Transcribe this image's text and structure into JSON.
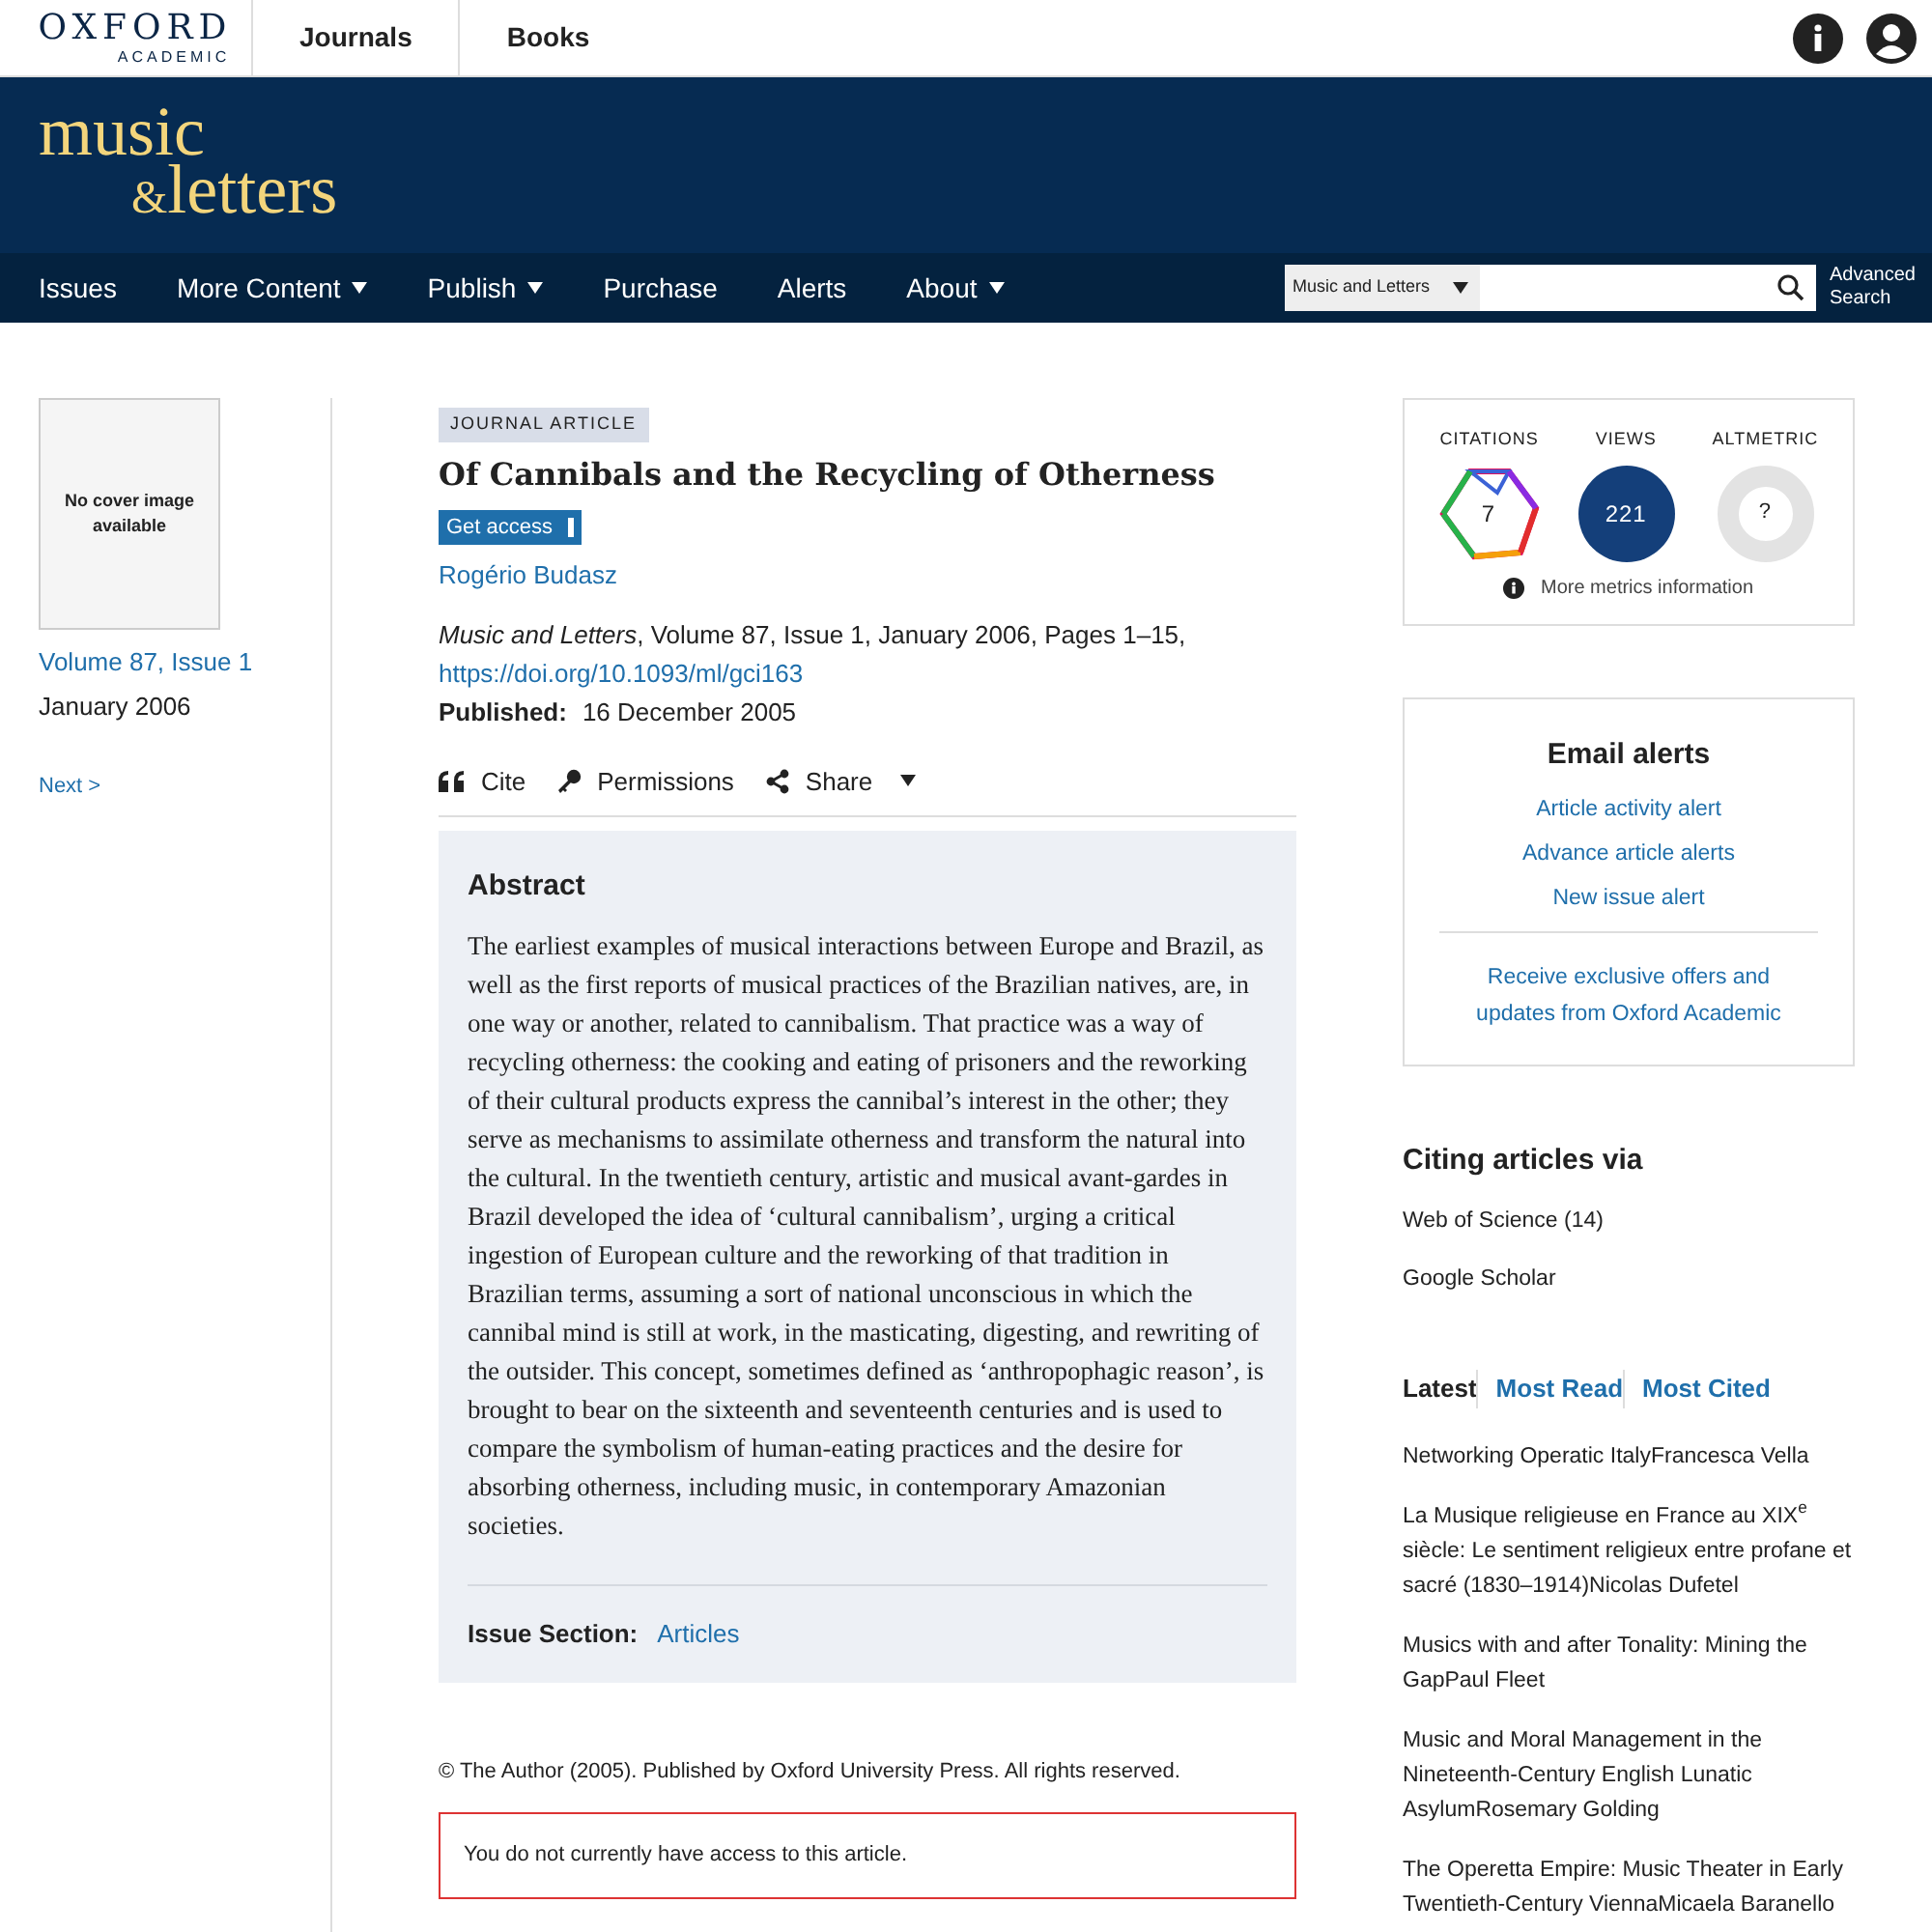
{
  "header": {
    "logo_name": "OXFORD",
    "logo_sub": "ACADEMIC",
    "links": [
      {
        "label": "Journals"
      },
      {
        "label": "Books"
      }
    ]
  },
  "journal_logo": {
    "line_1": "music",
    "ampersand": "&",
    "line_2": "letters"
  },
  "nav": {
    "items": [
      {
        "label": "Issues",
        "has_menu": false
      },
      {
        "label": "More Content",
        "has_menu": true
      },
      {
        "label": "Publish",
        "has_menu": true
      },
      {
        "label": "Purchase",
        "has_menu": false
      },
      {
        "label": "Alerts",
        "has_menu": false
      },
      {
        "label": "About",
        "has_menu": true
      }
    ],
    "search": {
      "scope": "Music and Letters",
      "advanced": "Advanced Search"
    }
  },
  "issue_sidebar": {
    "cover_text": "No cover image available",
    "issue": "Volume 87, Issue 1",
    "date": "January 2006",
    "next": "Next >"
  },
  "article": {
    "type": "JOURNAL ARTICLE",
    "title": "Of Cannibals and the Recycling of Otherness",
    "get_access": "Get access",
    "author": "Rogério Budasz",
    "citation": "*Music and Letters*, Volume 87, Issue 1, January 2006, Pages 1–15,",
    "doi": "https://doi.org/10.1093/ml/gci163",
    "published_label": "Published:",
    "published_date": "16 December 2005",
    "tools": [
      {
        "kind": "cite",
        "label": "Cite",
        "has_menu": false
      },
      {
        "kind": "permissions",
        "label": "Permissions",
        "has_menu": false
      },
      {
        "kind": "share",
        "label": "Share",
        "has_menu": true
      }
    ]
  },
  "abstract": {
    "heading": "Abstract",
    "text": "The earliest examples of musical interactions between Europe and Brazil, as well as the first reports of musical practices of the Brazilian natives, are, in one way or another, related to cannibalism. That practice was a way of recycling otherness: the cooking and eating of prisoners and the reworking of their cultural products express the cannibal’s interest in the other; they serve as mechanisms to assimilate otherness and transform the natural into the cultural. In the twentieth century, artistic and musical avant-gardes in Brazil developed the idea of ‘cultural cannibalism’, urging a critical ingestion of European culture and the reworking of that tradition in Brazilian terms, assuming a sort of national unconscious in which the cannibal mind is still at work, in the masticating, digesting, and rewriting of the outsider. This concept, sometimes defined as ‘anthropophagic reason’, is brought to bear on the sixteenth and seventeenth centuries and is used to compare the symbolism of human-eating practices and the desire for absorbing otherness, including music, in contemporary Amazonian societies.",
    "issue_section_label": "Issue Section:",
    "issue_section": "Articles"
  },
  "copyright": "© The Author (2005). Published by Oxford University Press. All rights reserved.",
  "access_notice": "You do not currently have access to this article.",
  "metrics": {
    "citations_label": "CITATIONS",
    "citations": "7",
    "views_label": "VIEWS",
    "views": "221",
    "altmetric_label": "ALTMETRIC",
    "altmetric": "?",
    "more_info": "More metrics information"
  },
  "email_alerts": {
    "title": "Email alerts",
    "links": [
      "Article activity alert",
      "Advance article alerts",
      "New issue alert"
    ],
    "offers": "Receive exclusive offers and updates from Oxford Academic"
  },
  "citing_articles": {
    "title": "Citing articles via",
    "sources": [
      "Web of Science (14)",
      "Google Scholar"
    ]
  },
  "article_tabs": [
    {
      "label": "Latest",
      "selected": true
    },
    {
      "label": "Most Read",
      "selected": false
    },
    {
      "label": "Most Cited",
      "selected": false
    }
  ],
  "latest_articles": [
    "Networking Operatic ItalyFrancesca Vella",
    "La Musique religieuse en France au XIX$^{e}$ siècle: Le sentiment religieux entre profane et sacré (1830–1914)Nicolas Dufetel",
    "Musics with and after Tonality: Mining the GapPaul Fleet",
    "Music and Moral Management in the Nineteenth-Century English Lunatic AsylumRosemary Golding",
    "The Operetta Empire: Music Theater in Early Twentieth-Century ViennaMicaela Baranello"
  ]
}
